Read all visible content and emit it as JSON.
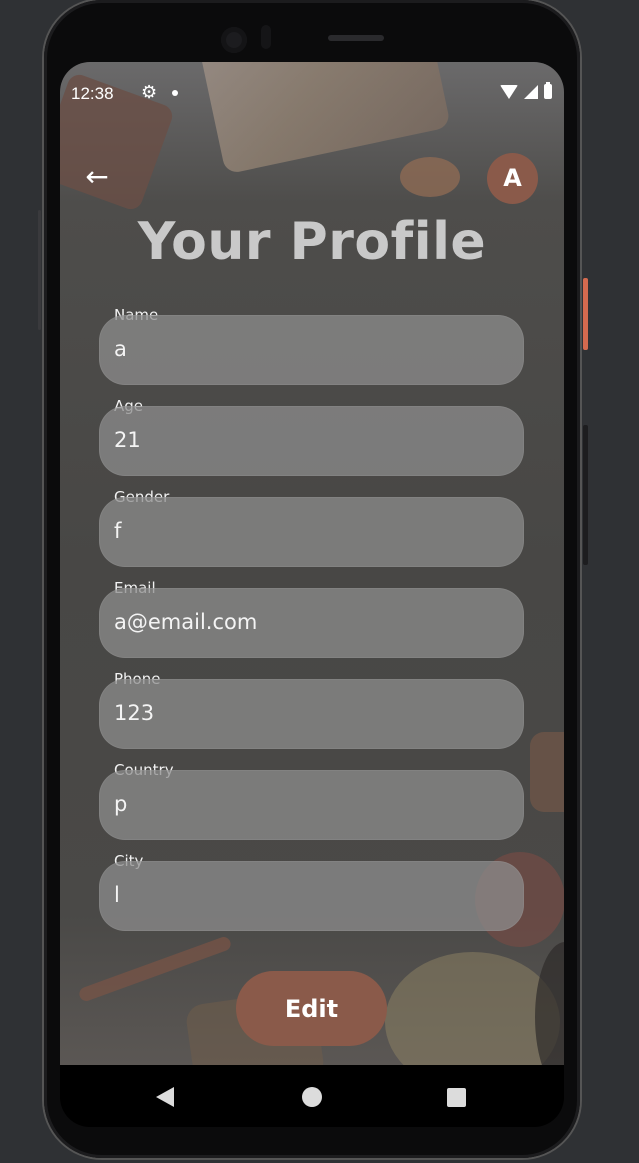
{
  "status_bar": {
    "time": "12:38",
    "settings_icon": "gear-icon",
    "wifi_icon": "wifi-icon",
    "signal_icon": "signal-icon",
    "battery_icon": "battery-icon"
  },
  "header": {
    "back_icon": "arrow-left-icon",
    "back_glyph": "←",
    "avatar_initial": "A",
    "title": "Your Profile"
  },
  "fields": [
    {
      "label": "Name",
      "value": "a"
    },
    {
      "label": "Age",
      "value": "21"
    },
    {
      "label": "Gender",
      "value": "f"
    },
    {
      "label": "Email",
      "value": "a@email.com"
    },
    {
      "label": "Phone",
      "value": "123"
    },
    {
      "label": "Country",
      "value": "p"
    },
    {
      "label": "City",
      "value": "l"
    }
  ],
  "actions": {
    "edit_label": "Edit"
  },
  "navigation": {
    "back_icon": "triangle-back-icon",
    "home_icon": "circle-home-icon",
    "recents_icon": "square-recents-icon"
  },
  "colors": {
    "accent": "#8a5a4a",
    "field_bg": "#8c8c8c",
    "title_color": "#c9c9c9",
    "background": "#484745"
  }
}
